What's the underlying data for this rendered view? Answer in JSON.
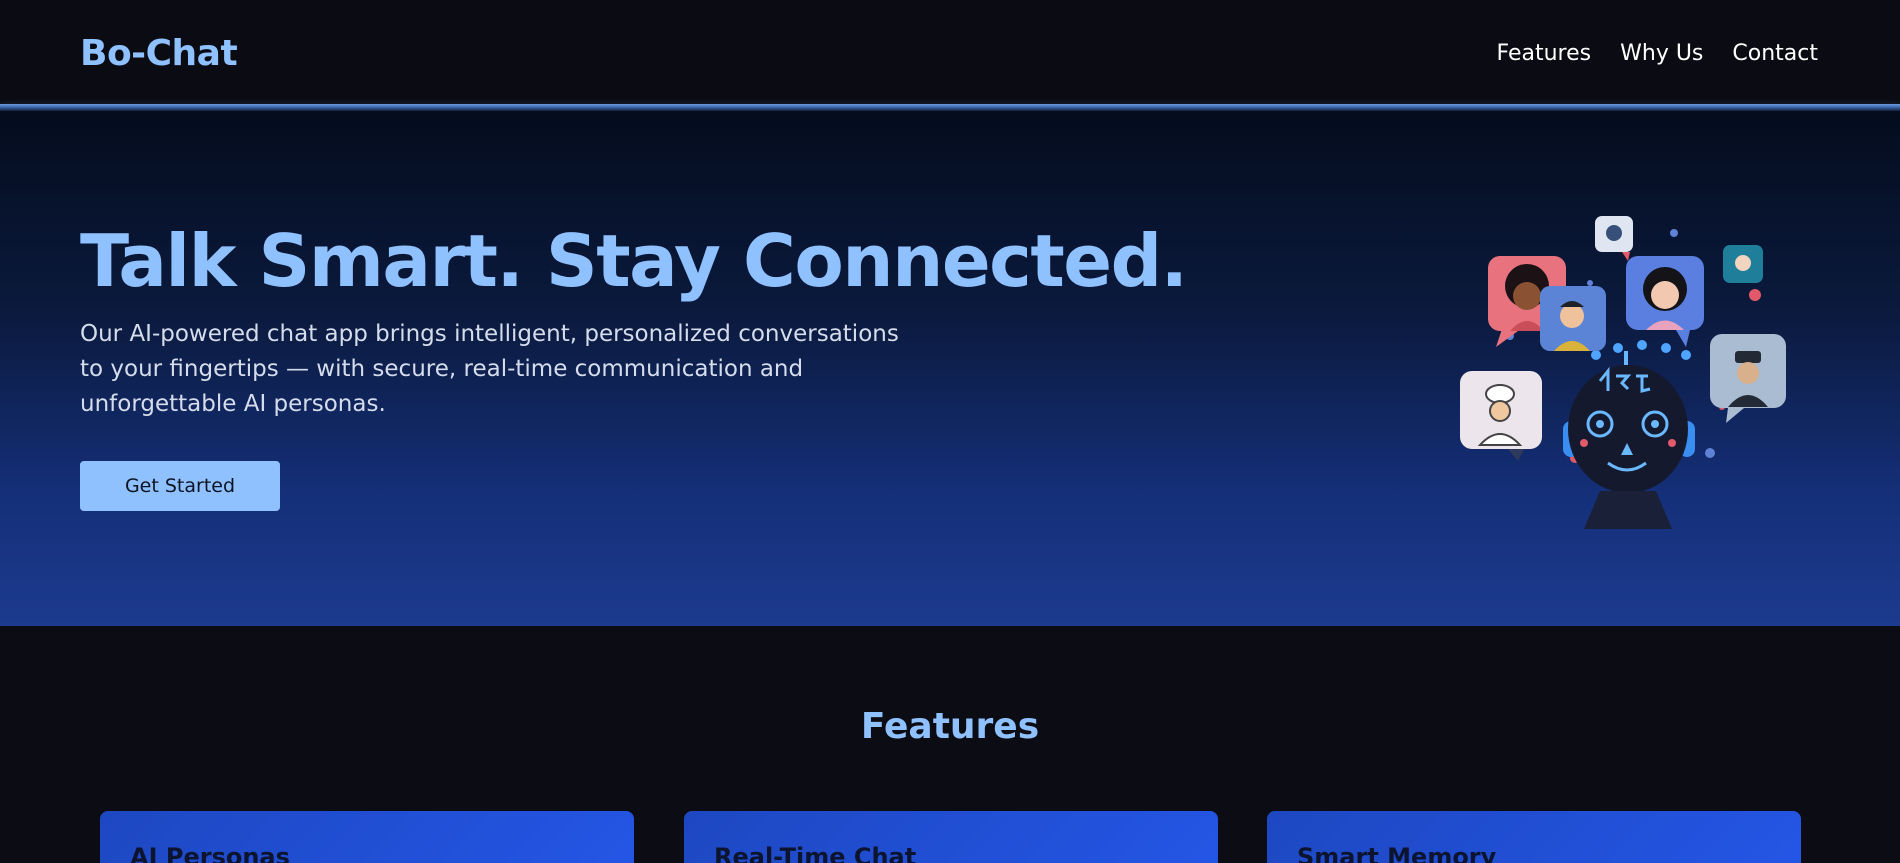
{
  "header": {
    "brand": "Bo-Chat",
    "nav": [
      {
        "label": "Features"
      },
      {
        "label": "Why Us"
      },
      {
        "label": "Contact"
      }
    ]
  },
  "hero": {
    "title": "Talk Smart. Stay Connected.",
    "description": "Our AI-powered chat app brings intelligent, personalized conversations to your fingertips — with secure, real-time communication and unforgettable AI personas.",
    "cta_label": "Get Started",
    "illustration": "ai-chat-robot-with-avatar-bubbles"
  },
  "features": {
    "heading": "Features",
    "cards": [
      {
        "title": "AI Personas"
      },
      {
        "title": "Real-Time Chat"
      },
      {
        "title": "Smart Memory"
      }
    ]
  },
  "colors": {
    "accent": "#8fc1ff",
    "background": "#0c0d14",
    "card": "#2456e6"
  }
}
